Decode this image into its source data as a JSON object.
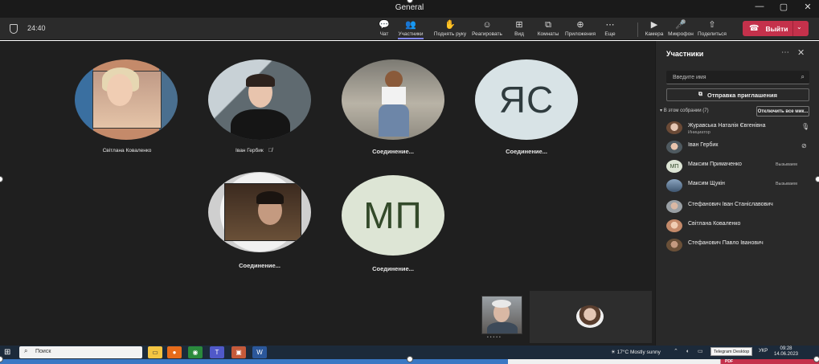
{
  "window": {
    "title": "General"
  },
  "meeting": {
    "timer": "24:40"
  },
  "toolbar": {
    "items": [
      {
        "label": "Чат",
        "icon": "chat-icon"
      },
      {
        "label": "Участники",
        "icon": "people-icon"
      },
      {
        "label": "Поднять руку",
        "icon": "raise-hand-icon"
      },
      {
        "label": "Реагировать",
        "icon": "react-icon"
      },
      {
        "label": "Вид",
        "icon": "view-icon"
      },
      {
        "label": "Комнаты",
        "icon": "rooms-icon"
      },
      {
        "label": "Приложения",
        "icon": "apps-icon"
      },
      {
        "label": "Еще",
        "icon": "more-icon"
      }
    ],
    "devices": [
      {
        "label": "Камера",
        "icon": "camera-icon"
      },
      {
        "label": "Микрофон",
        "icon": "microphone-icon"
      },
      {
        "label": "Поделиться",
        "icon": "share-icon"
      }
    ],
    "leave_label": "Выйти",
    "leave_color": "#c4314b",
    "active_item": "Участники"
  },
  "stage": {
    "tiles": [
      {
        "name": "Світлана Коваленко",
        "type": "video"
      },
      {
        "name": "Іван Гербик",
        "type": "video",
        "muted": true
      },
      {
        "name": "Соединение...",
        "type": "photo"
      },
      {
        "name": "Соединение...",
        "type": "initials",
        "initials": "ЯС"
      },
      {
        "name": "Соединение...",
        "type": "video"
      },
      {
        "name": "Соединение...",
        "type": "initials",
        "initials": "МП"
      }
    ]
  },
  "panel": {
    "title": "Участники",
    "search_placeholder": "Введите имя",
    "invite_label": "Отправка приглашения",
    "section_label": "В этом собрании (7)",
    "mute_all_label": "Отключить все мик...",
    "participants": [
      {
        "name": "Журавська Наталія Євгенівна",
        "role": "Инициатор",
        "status": "",
        "mic": "on"
      },
      {
        "name": "Іван Гербик",
        "role": "",
        "status": "",
        "mic": "off"
      },
      {
        "name": "Максим Примаченко",
        "role": "",
        "status": "Вызываем",
        "initials": "МП"
      },
      {
        "name": "Максим Щукін",
        "role": "",
        "status": "Вызываем"
      },
      {
        "name": "Стефанович Іван Станіславович",
        "role": "",
        "status": ""
      },
      {
        "name": "Світлана Коваленко",
        "role": "",
        "status": ""
      },
      {
        "name": "Стефанович Павло Іванович",
        "role": "",
        "status": ""
      }
    ]
  },
  "taskbar": {
    "search_label": "Поиск",
    "weather": "17°C  Mostly sunny",
    "tooltip": "Telegram Desktop",
    "lang": "УКР",
    "time": "09:28",
    "date": "14.06.2023"
  }
}
